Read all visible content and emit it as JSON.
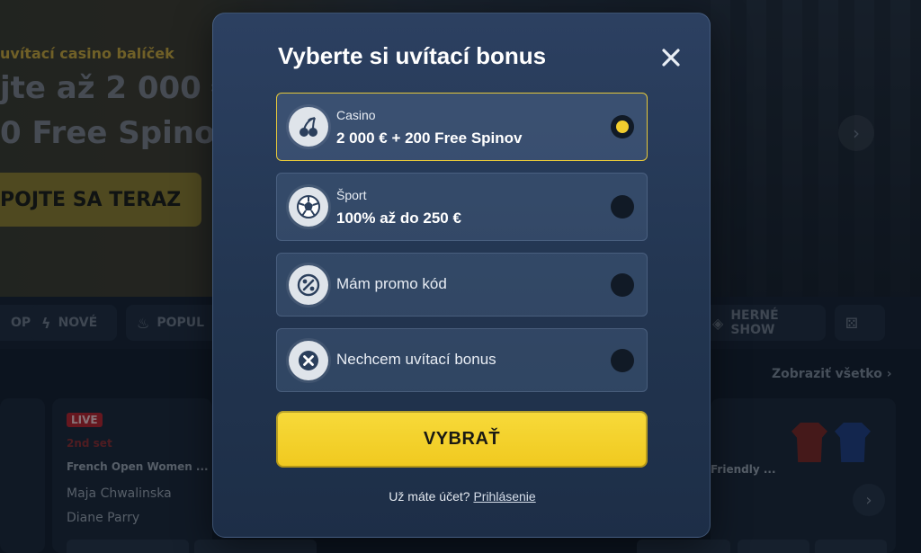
{
  "background": {
    "hero": {
      "promo_label": "uvítací casino balíček",
      "headline_line1": "jte až 2 000 €",
      "headline_line2": "0 Free Spinov",
      "cta_label": "POJTE SA TERAZ"
    },
    "categories": [
      {
        "label": "OP"
      },
      {
        "label": "NOVÉ",
        "icon": "lightning-icon"
      },
      {
        "label": "POPUL",
        "icon": "flame-icon"
      },
      {
        "label": "HERNÉ SHOW",
        "icon": "show-icon"
      }
    ],
    "see_all": "Zobraziť všetko",
    "match_card": {
      "badge": "LIVE",
      "set": "2nd set",
      "event": "French Open Women ...",
      "player1": "Maja Chwalinska",
      "player2": "Diane Parry"
    },
    "match_card_right": {
      "event": "Friendly ..."
    }
  },
  "modal": {
    "title": "Vyberte si uvítací bonus",
    "options": [
      {
        "sub": "Casino",
        "main": "2 000 € + 200 Free Spinov",
        "icon": "cherry-icon",
        "selected": true
      },
      {
        "sub": "Šport",
        "main": "100% až do 250 €",
        "icon": "soccer-ball-icon",
        "selected": false
      },
      {
        "main": "Mám promo kód",
        "icon": "percent-icon",
        "selected": false
      },
      {
        "main": "Nechcem uvítací bonus",
        "icon": "x-circle-icon",
        "selected": false
      }
    ],
    "cta_label": "VYBRAŤ",
    "login_prompt": "Už máte účet?",
    "login_link": "Prihlásenie"
  },
  "colors": {
    "accent_yellow": "#f2cd2e",
    "modal_bg": "#2c4061",
    "live_red": "#b7222b"
  }
}
